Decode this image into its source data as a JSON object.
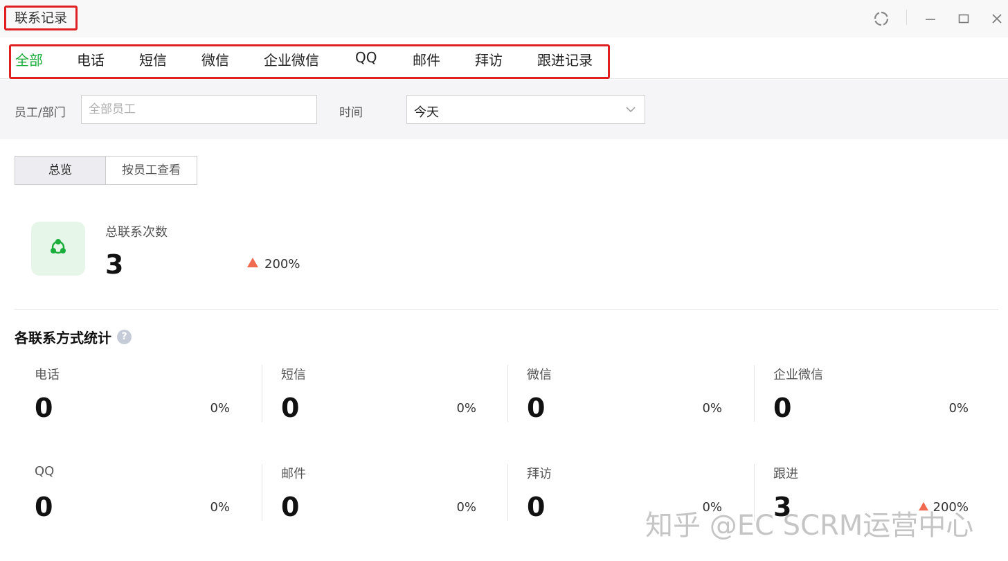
{
  "window": {
    "title": "联系记录"
  },
  "tabs": [
    {
      "label": "全部",
      "active": true
    },
    {
      "label": "电话",
      "active": false
    },
    {
      "label": "短信",
      "active": false
    },
    {
      "label": "微信",
      "active": false
    },
    {
      "label": "企业微信",
      "active": false
    },
    {
      "label": "QQ",
      "active": false
    },
    {
      "label": "邮件",
      "active": false
    },
    {
      "label": "拜访",
      "active": false
    },
    {
      "label": "跟进记录",
      "active": false
    }
  ],
  "filters": {
    "employee_label": "员工/部门",
    "employee_placeholder": "全部员工",
    "time_label": "时间",
    "time_value": "今天"
  },
  "view_toggle": {
    "overview": "总览",
    "by_employee": "按员工查看"
  },
  "summary": {
    "label": "总联系次数",
    "value": "3",
    "trend": "200%",
    "trend_direction": "up"
  },
  "section": {
    "title": "各联系方式统计"
  },
  "stats": [
    {
      "label": "电话",
      "value": "0",
      "pct": "0%"
    },
    {
      "label": "短信",
      "value": "0",
      "pct": "0%"
    },
    {
      "label": "微信",
      "value": "0",
      "pct": "0%"
    },
    {
      "label": "企业微信",
      "value": "0",
      "pct": "0%"
    },
    {
      "label": "QQ",
      "value": "0",
      "pct": "0%"
    },
    {
      "label": "邮件",
      "value": "0",
      "pct": "0%"
    },
    {
      "label": "拜访",
      "value": "0",
      "pct": "0%"
    },
    {
      "label": "跟进",
      "value": "3",
      "pct": "200%"
    }
  ],
  "watermark": "知乎 @EC SCRM运营中心",
  "colors": {
    "accent": "#1aad3c",
    "highlight_border": "#e02020",
    "trend_up": "#f06a50"
  },
  "icons": {
    "summary": "contact-network-icon",
    "refresh": "refresh-icon",
    "minimize": "minimize-icon",
    "maximize": "maximize-icon",
    "close": "close-icon"
  }
}
